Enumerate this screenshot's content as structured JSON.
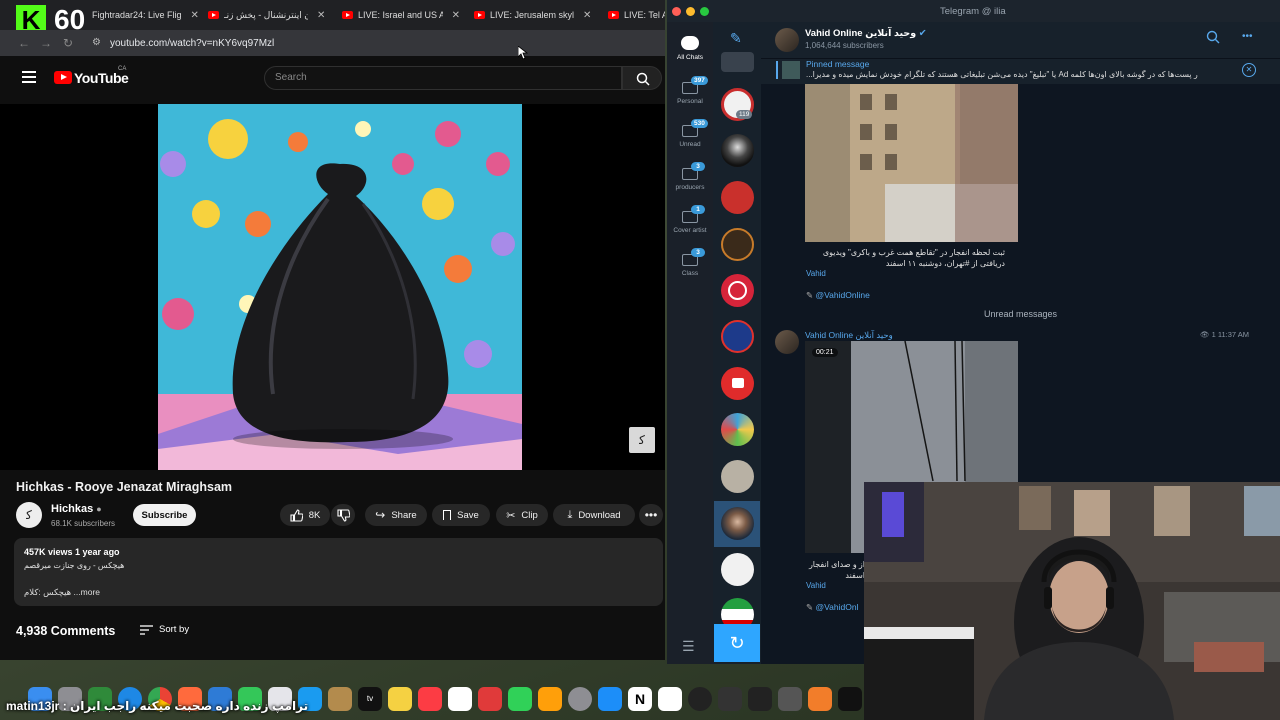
{
  "stream": {
    "fps": "60",
    "logo": "K",
    "caption": "ترامپ زنده داره صحبت میکنه راجب ایران : matin13jr"
  },
  "browser": {
    "tabs": [
      {
        "label": "Fightradar24: Live Flig"
      },
      {
        "label": "ایران اینترنشنال - پخش زنـ"
      },
      {
        "label": "LIVE: Israel and US Att"
      },
      {
        "label": "LIVE: Jerusalem skylin"
      },
      {
        "label": "LIVE: Tel Av"
      }
    ],
    "url": "youtube.com/watch?v=nKY6vq97Mzl"
  },
  "youtube": {
    "logo_text": "YouTube",
    "country": "CA",
    "search_placeholder": "Search",
    "video_title": "Hichkas - Rooye Jenazat Miraghsam",
    "channel_name": "Hichkas",
    "channel_subs": "68.1K subscribers",
    "subscribe_label": "Subscribe",
    "likes": "8K",
    "share_label": "Share",
    "save_label": "Save",
    "clip_label": "Clip",
    "download_label": "Download",
    "views_line": "457K views  1 year ago",
    "desc_line": "هیچکس - روی جنازت میرقصم",
    "desc_more": "...more",
    "desc_more_prefix": "هیچکس :کلام",
    "comments_count": "4,938 Comments",
    "sort_label": "Sort by",
    "watermark": "ﮐ"
  },
  "telegram": {
    "window_title": "Telegram @ ilia",
    "folders": [
      {
        "label": "All Chats",
        "badge": ""
      },
      {
        "label": "Personal",
        "badge": "397"
      },
      {
        "label": "Unread",
        "badge": "530"
      },
      {
        "label": "producers",
        "badge": "3"
      },
      {
        "label": "Cover artist",
        "badge": "1"
      },
      {
        "label": "Class",
        "badge": "3"
      }
    ],
    "chat_badge": "119",
    "channel_name": "Vahid Online وحید آنلاین",
    "channel_subs": "1,064,644 subscribers",
    "pinned_title": "Pinned message",
    "pinned_text": "ر پست‌ها که در گوشه بالای اون‌ها کلمه Ad یا \"تبلیغ\" دیده می‌شن تبلیغاتی هستند که تلگرام خودش نمایش میده و مدیرا...",
    "msg1_caption": "ثبت لحظه انفجار در \"تقاطع همت غرب و باکری\" ویدیوی دریافتی از #تهران، دوشنبه ۱۱ اسفند",
    "msg1_sender": "Vahid",
    "handle": "@VahidOnline",
    "unread_label": "Unread messages",
    "msg2_sender": "Vahid Online وحید آنلاین",
    "msg2_time": "1 11:37 AM",
    "msg2_duration": "00:21",
    "msg2_caption": "از و صدای انفجار اسفند",
    "msg2_sender_short": "Vahid",
    "handle_short": "@VahidOnl"
  }
}
